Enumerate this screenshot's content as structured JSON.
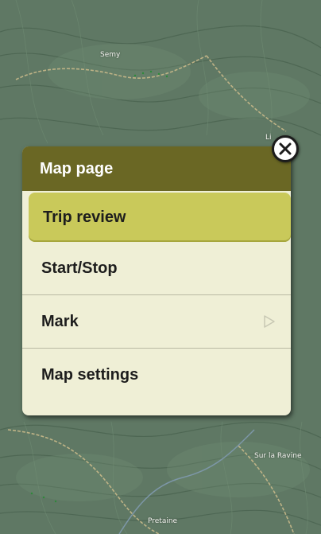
{
  "map": {
    "place_labels": [
      "Semy",
      "Li",
      "Sur la Ravine",
      "Pretaine"
    ],
    "colors": {
      "terrain": "#5f7864",
      "contour": "#3f5544",
      "path": "#c9b98a",
      "river": "#7d97a8"
    }
  },
  "menu": {
    "title": "Map page",
    "items": [
      {
        "label": "Trip review",
        "selected": true,
        "submenu": false
      },
      {
        "label": "Start/Stop",
        "selected": false,
        "submenu": false
      },
      {
        "label": "Mark",
        "selected": false,
        "submenu": true
      },
      {
        "label": "Map settings",
        "selected": false,
        "submenu": false
      }
    ],
    "colors": {
      "header": "#6a6724",
      "background": "#efefd6",
      "selected": "#c9c95a"
    },
    "submenu_icon": "chevron-right-icon",
    "close_icon": "close-icon"
  }
}
